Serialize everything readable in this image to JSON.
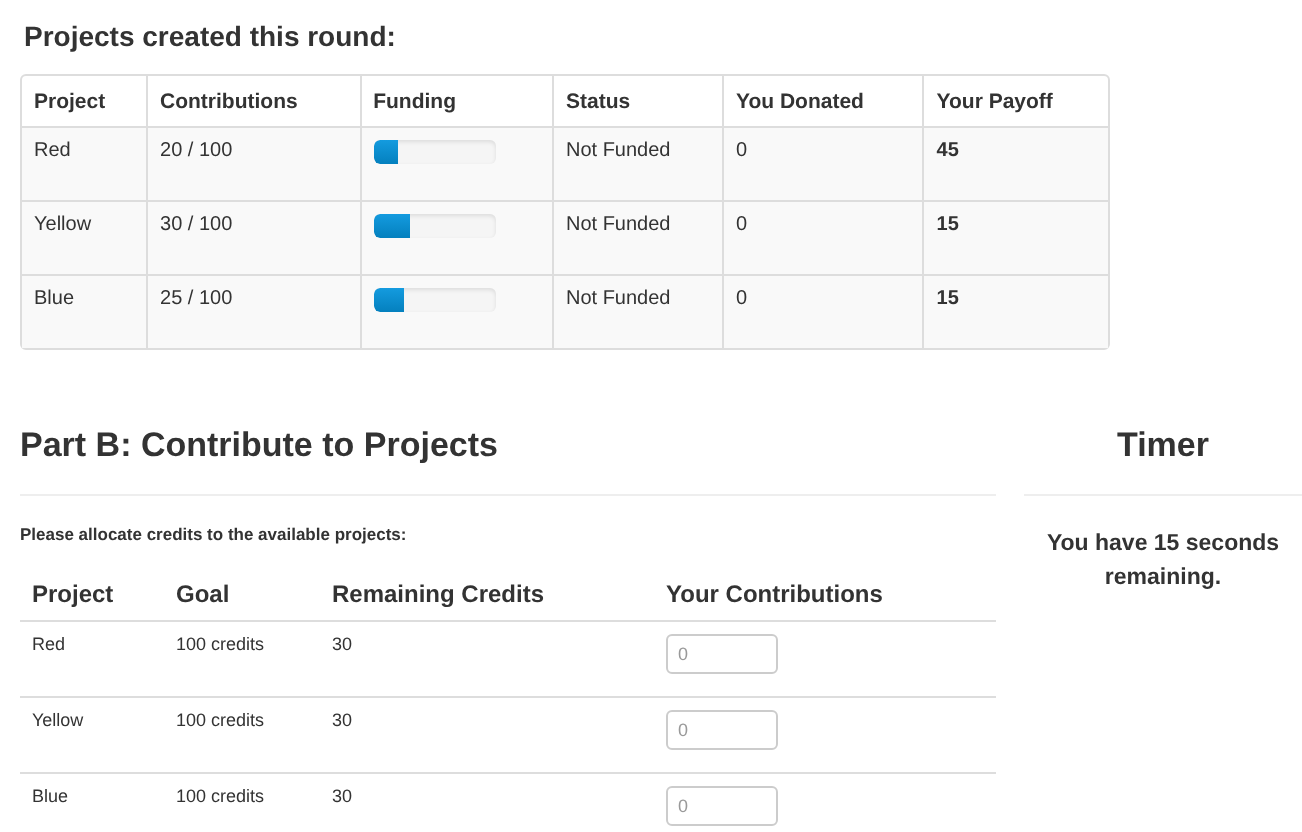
{
  "summary": {
    "title": "Projects created this round:",
    "columns": [
      "Project",
      "Contributions",
      "Funding",
      "Status",
      "You Donated",
      "Your Payoff"
    ],
    "rows": [
      {
        "project": "Red",
        "contributions": "20 / 100",
        "level": 0.2,
        "status": "Not Funded",
        "donated": "0",
        "payoff": "45"
      },
      {
        "project": "Yellow",
        "contributions": "30 / 100",
        "level": 0.3,
        "status": "Not Funded",
        "donated": "0",
        "payoff": "15"
      },
      {
        "project": "Blue",
        "contributions": "25 / 100",
        "level": 0.25,
        "status": "Not Funded",
        "donated": "0",
        "payoff": "15"
      }
    ]
  },
  "part_b": {
    "title": "Part B: Contribute to Projects",
    "instruction": "Please allocate credits to the available projects:",
    "columns": [
      "Project",
      "Goal",
      "Remaining Credits",
      "Your Contributions"
    ],
    "rows": [
      {
        "project": "Red",
        "goal": "100 credits",
        "remaining": "30",
        "placeholder": "0"
      },
      {
        "project": "Yellow",
        "goal": "100 credits",
        "remaining": "30",
        "placeholder": "0"
      },
      {
        "project": "Blue",
        "goal": "100 credits",
        "remaining": "30",
        "placeholder": "0"
      }
    ]
  },
  "timer": {
    "title": "Timer",
    "message": "You have 15 seconds remaining."
  }
}
